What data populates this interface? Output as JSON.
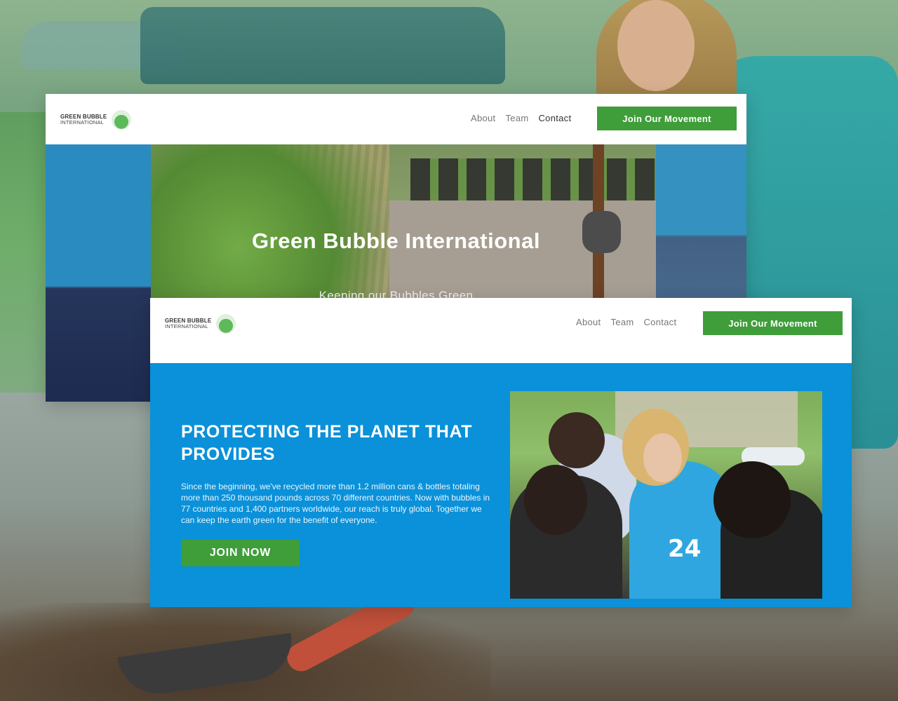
{
  "brand": {
    "line1": "GREEN BUBBLE",
    "line2": "INTERNATIONAL"
  },
  "nav": {
    "links": [
      "About",
      "Team",
      "Contact"
    ],
    "cta": "Join Our Movement"
  },
  "hero": {
    "title": "Green Bubble International",
    "subtitle": "Keeping our Bubbles Green"
  },
  "mission": {
    "title": "PROTECTING THE PLANET THAT PROVIDES",
    "body": "Since the beginning, we've recycled more than 1.2 million cans & bottles totaling more than 250 thousand pounds across 70 different countries. Now with bubbles in 77 countries and 1,400 partners worldwide, our reach is truly global. Together we can keep the earth green for the benefit of everyone.",
    "button": "JOIN NOW",
    "photo_text": "24"
  },
  "colors": {
    "accent_green": "#3f9d3a",
    "mission_blue": "#0a91d9"
  }
}
